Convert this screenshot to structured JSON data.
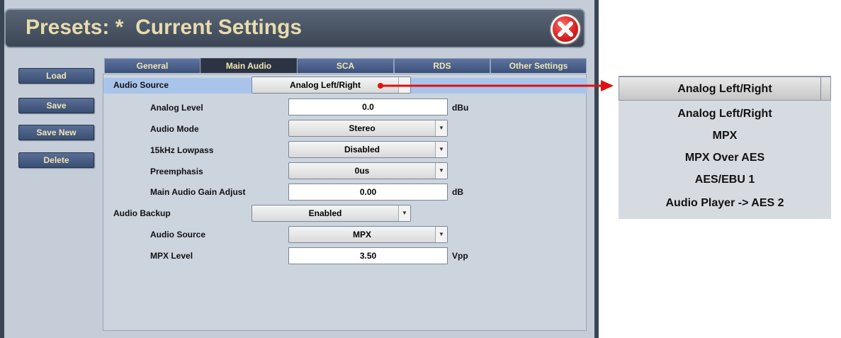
{
  "window": {
    "title": "Presets: *  Current Settings"
  },
  "sidebar": {
    "buttons": [
      {
        "label": "Load"
      },
      {
        "label": "Save"
      },
      {
        "label": "Save New"
      },
      {
        "label": "Delete"
      }
    ]
  },
  "tabs": [
    {
      "label": "General",
      "active": false
    },
    {
      "label": "Main Audio",
      "active": true
    },
    {
      "label": "SCA",
      "active": false
    },
    {
      "label": "RDS",
      "active": false
    },
    {
      "label": "Other Settings",
      "active": false
    }
  ],
  "form": {
    "audio_source": {
      "label": "Audio Source",
      "value": "Analog Left/Right"
    },
    "analog_level": {
      "label": "Analog Level",
      "value": "0.0",
      "unit": "dBu"
    },
    "audio_mode": {
      "label": "Audio Mode",
      "value": "Stereo"
    },
    "lowpass": {
      "label": "15kHz Lowpass",
      "value": "Disabled"
    },
    "preemphasis": {
      "label": "Preemphasis",
      "value": "0us"
    },
    "gain_adjust": {
      "label": "Main Audio Gain Adjust",
      "value": "0.00",
      "unit": "dB"
    },
    "audio_backup": {
      "label": "Audio Backup",
      "value": "Enabled"
    },
    "backup_source": {
      "label": "Audio Source",
      "value": "MPX"
    },
    "mpx_level": {
      "label": "MPX Level",
      "value": "3.50",
      "unit": "Vpp"
    }
  },
  "dropdown_popup": {
    "selected": "Analog Left/Right",
    "options": [
      "Analog Left/Right",
      "MPX",
      "MPX Over AES",
      "AES/EBU 1",
      "Audio Player -> AES 2"
    ]
  },
  "colors": {
    "arrow": "#e01010",
    "title_text": "#e7dcae",
    "button_text": "#f1e6b2",
    "highlight_row": "#a9c4ea"
  }
}
